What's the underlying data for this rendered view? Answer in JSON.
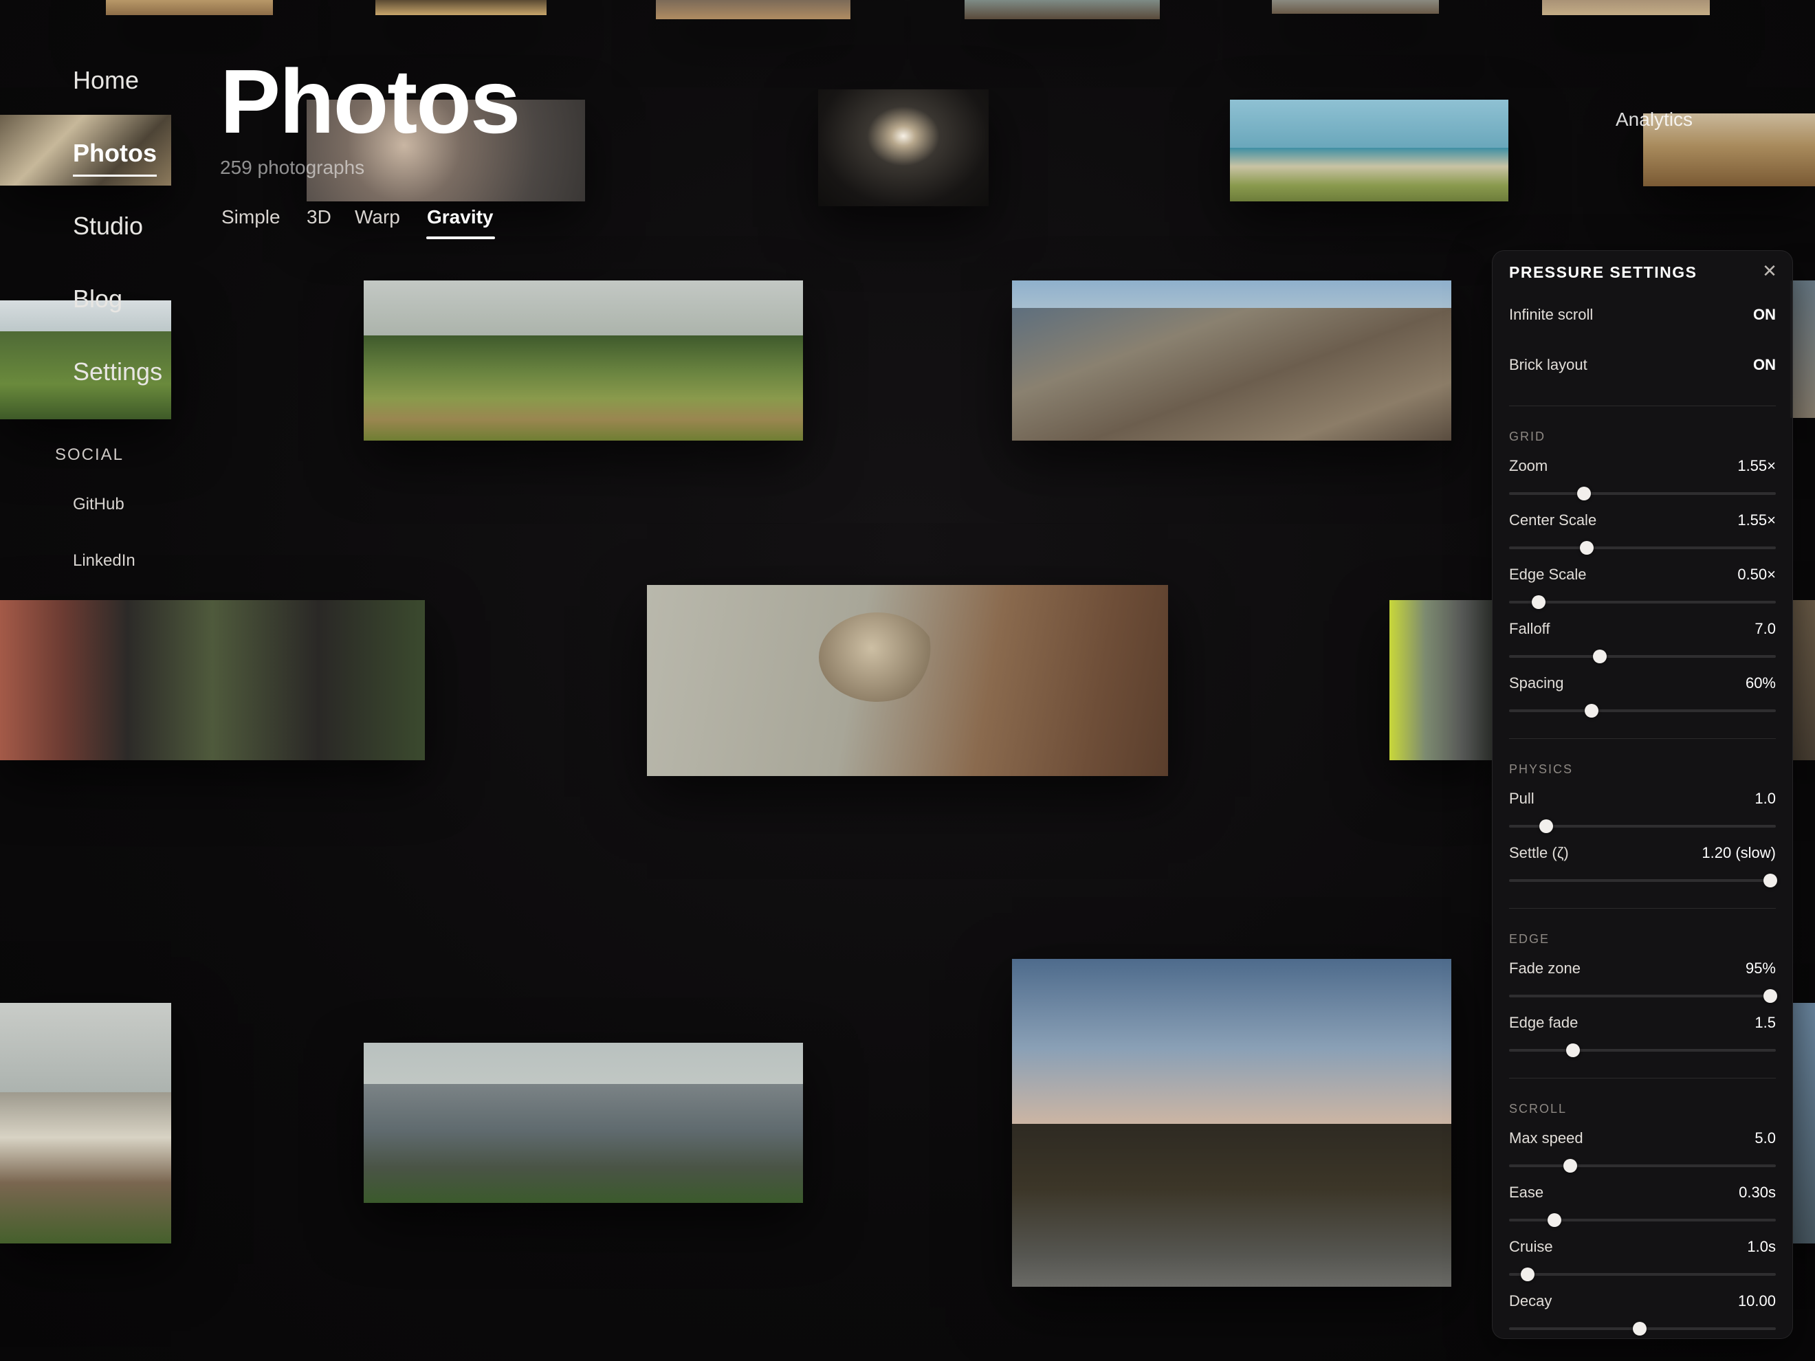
{
  "nav": {
    "items": [
      {
        "label": "Home"
      },
      {
        "label": "Photos"
      },
      {
        "label": "Studio"
      },
      {
        "label": "Blog"
      },
      {
        "label": "Settings"
      }
    ],
    "social_heading": "SOCIAL",
    "social_links": [
      {
        "label": "GitHub"
      },
      {
        "label": "LinkedIn"
      }
    ]
  },
  "header": {
    "title": "Photos",
    "subtitle": "259 photographs",
    "tabs": [
      {
        "label": "Simple"
      },
      {
        "label": "3D"
      },
      {
        "label": "Warp"
      },
      {
        "label": "Gravity",
        "active": true
      }
    ],
    "top_right_link": "Analytics"
  },
  "panel": {
    "title": "PRESSURE SETTINGS",
    "close_icon": "close-icon",
    "toggles": [
      {
        "label": "Infinite scroll",
        "value": "ON"
      },
      {
        "label": "Brick layout",
        "value": "ON"
      }
    ],
    "sections": {
      "grid": "GRID",
      "physics": "PHYSICS",
      "edge": "EDGE",
      "scroll": "SCROLL"
    },
    "sliders": {
      "zoom": {
        "label": "Zoom",
        "value": "1.55×",
        "level": 0.28
      },
      "center_scale": {
        "label": "Center Scale",
        "value": "1.55×",
        "level": 0.29
      },
      "edge_scale": {
        "label": "Edge Scale",
        "value": "0.50×",
        "level": 0.11
      },
      "falloff": {
        "label": "Falloff",
        "value": "7.0",
        "level": 0.34
      },
      "spacing": {
        "label": "Spacing",
        "value": "60%",
        "level": 0.31
      },
      "pull": {
        "label": "Pull",
        "value": "1.0",
        "level": 0.14
      },
      "settle": {
        "label": "Settle (ζ)",
        "value": "1.20 (slow)",
        "level": 0.98
      },
      "fade_zone": {
        "label": "Fade zone",
        "value": "95%",
        "level": 0.98
      },
      "edge_fade": {
        "label": "Edge fade",
        "value": "1.5",
        "level": 0.24
      },
      "max_speed": {
        "label": "Max speed",
        "value": "5.0",
        "level": 0.23
      },
      "ease": {
        "label": "Ease",
        "value": "0.30s",
        "level": 0.17
      },
      "cruise": {
        "label": "Cruise",
        "value": "1.0s",
        "level": 0.07
      },
      "decay": {
        "label": "Decay",
        "value": "10.00",
        "level": 0.49
      }
    }
  },
  "colors": {
    "background": "#0b0a0b",
    "panel": "#141315",
    "accent": "#ffffff"
  }
}
